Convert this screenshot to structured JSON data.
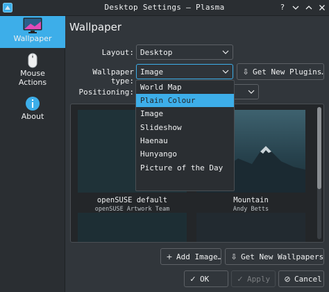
{
  "window": {
    "title": "Desktop Settings — Plasma"
  },
  "sidebar": {
    "items": [
      {
        "label": "Wallpaper",
        "icon": "monitor-icon",
        "active": true
      },
      {
        "label": "Mouse Actions",
        "icon": "mouse-icon"
      },
      {
        "label": "About",
        "icon": "info-icon"
      }
    ]
  },
  "page": {
    "title": "Wallpaper"
  },
  "form": {
    "layout_label": "Layout:",
    "layout_value": "Desktop",
    "type_label": "Wallpaper type:",
    "type_value": "Image",
    "positioning_label": "Positioning:",
    "get_plugins_label": "Get New Plugins…"
  },
  "type_dropdown": {
    "options": [
      "World Map",
      "Plain Colour",
      "Image",
      "Slideshow",
      "Haenau",
      "Hunyango",
      "Picture of the Day"
    ],
    "highlighted": "Plain Colour"
  },
  "wallpapers": [
    {
      "title": "openSUSE default",
      "author": "openSUSE Artwork Team"
    },
    {
      "title": "Mountain",
      "author": "Andy Betts"
    }
  ],
  "actions": {
    "add_image": "Add Image…",
    "get_wallpapers": "Get New Wallpapers…",
    "ok": "OK",
    "apply": "Apply",
    "cancel": "Cancel"
  },
  "colors": {
    "accent": "#3daee9",
    "window_bg": "#31363b",
    "sidebar_bg": "#2a2e32"
  }
}
